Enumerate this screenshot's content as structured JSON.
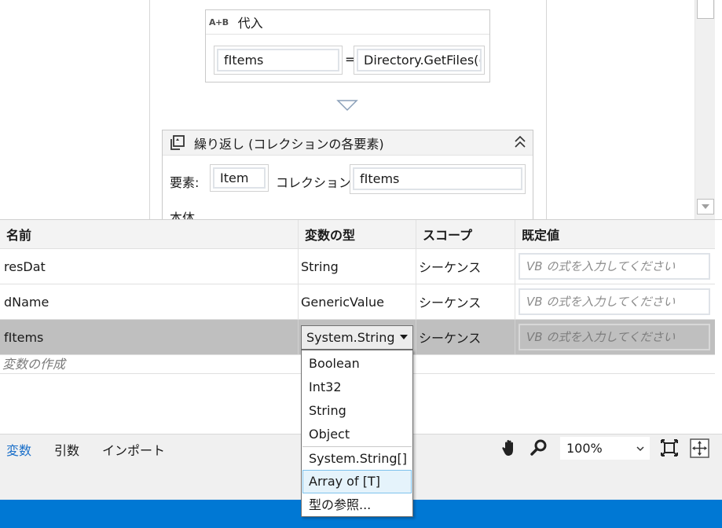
{
  "designer": {
    "assign": {
      "icon": "A+B",
      "title": "代入",
      "to": "fItems",
      "equals": "=",
      "value": "Directory.GetFiles(("
    },
    "foreach": {
      "title": "繰り返し (コレクションの各要素)",
      "item_label": "要素:",
      "item_value": "Item",
      "collection_label": "コレクション:",
      "collection_value": "fItems",
      "body_label": "本体"
    }
  },
  "variables": {
    "headers": {
      "name": "名前",
      "type": "変数の型",
      "scope": "スコープ",
      "default": "既定値"
    },
    "rows": [
      {
        "name": "resDat",
        "type": "String",
        "scope": "シーケンス",
        "default_placeholder": "VB の式を入力してください"
      },
      {
        "name": "dName",
        "type": "GenericValue",
        "scope": "シーケンス",
        "default_placeholder": "VB の式を入力してください"
      },
      {
        "name": "fItems",
        "type": "System.String",
        "scope": "シーケンス",
        "default_placeholder": "VB の式を入力してください"
      }
    ],
    "create_label": "変数の作成"
  },
  "type_dropdown": {
    "selected": "System.String",
    "options": [
      "Boolean",
      "Int32",
      "String",
      "Object",
      "System.String[]",
      "Array of [T]",
      "型の参照..."
    ],
    "hovered": "Array of [T]"
  },
  "bottom_bar": {
    "tabs": [
      "変数",
      "引数",
      "インポート"
    ],
    "active_tab": "変数",
    "zoom": "100%",
    "icons": [
      "hand-icon",
      "search-icon",
      "fit-to-screen-icon",
      "overview-icon"
    ]
  },
  "colors": {
    "accent": "#0078d4",
    "active_tab": "#1a6fc9",
    "selected_row": "#bfbfbf",
    "hover": "#e5f3fb"
  }
}
